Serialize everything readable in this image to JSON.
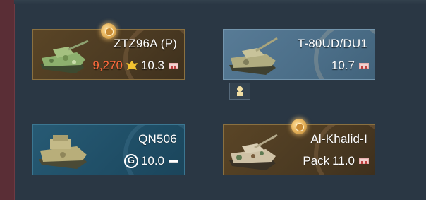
{
  "colors": {
    "background": "#2a3744",
    "research_points": "#ff6a3d",
    "card_premium": "#5a4526",
    "card_researched": "#587b96",
    "card_event": "#275a74"
  },
  "vehicles": [
    {
      "name": "ZTZ96A (P)",
      "research_points": "9,270",
      "br": "10.3",
      "status": "premium-squadron",
      "icons": [
        "medal-icon",
        "eagle-icon",
        "china-flag-icon"
      ]
    },
    {
      "name": "T-80UD/DU1",
      "br": "10.7",
      "status": "researched",
      "icons": [
        "china-flag-icon"
      ]
    },
    {
      "name": "QN506",
      "br": "10.0",
      "status": "event",
      "icons": [
        "golden-eagle-purchase-icon",
        "white-flag-icon"
      ]
    },
    {
      "name": "Al-Khalid-I",
      "pack_label": "Pack",
      "br": "11.0",
      "status": "premium-pack",
      "icons": [
        "medal-icon",
        "china-flag-icon"
      ]
    }
  ],
  "crew_slot_icon": "crew-slot-icon"
}
